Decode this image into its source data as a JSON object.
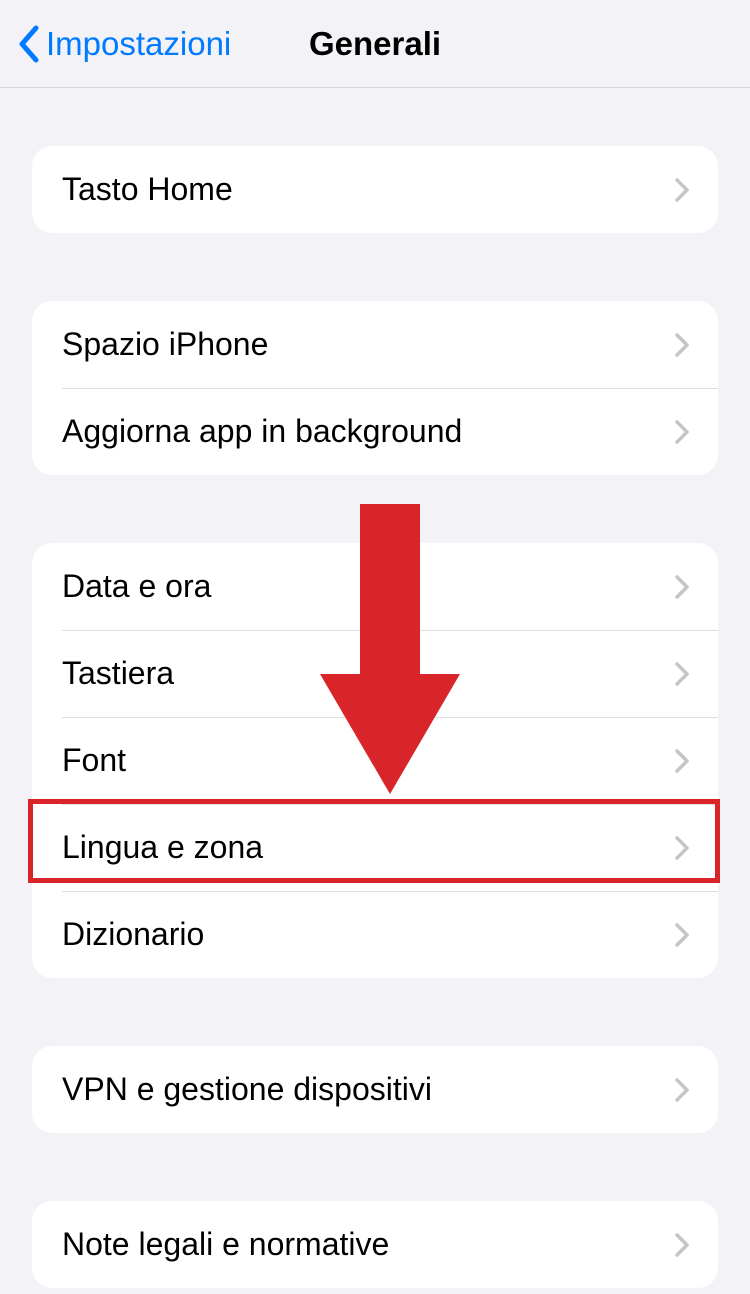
{
  "nav": {
    "back_label": "Impostazioni",
    "title": "Generali"
  },
  "groups": [
    {
      "rows": [
        {
          "label": "Tasto Home"
        }
      ]
    },
    {
      "rows": [
        {
          "label": "Spazio iPhone"
        },
        {
          "label": "Aggiorna app in background"
        }
      ]
    },
    {
      "rows": [
        {
          "label": "Data e ora"
        },
        {
          "label": "Tastiera"
        },
        {
          "label": "Font"
        },
        {
          "label": "Lingua e zona",
          "highlighted": true
        },
        {
          "label": "Dizionario"
        }
      ]
    },
    {
      "rows": [
        {
          "label": "VPN e gestione dispositivi"
        }
      ]
    },
    {
      "rows": [
        {
          "label": "Note legali e normative"
        }
      ]
    }
  ],
  "annotation": {
    "arrow_color": "#d9252a",
    "highlight_color": "#d9252a"
  }
}
